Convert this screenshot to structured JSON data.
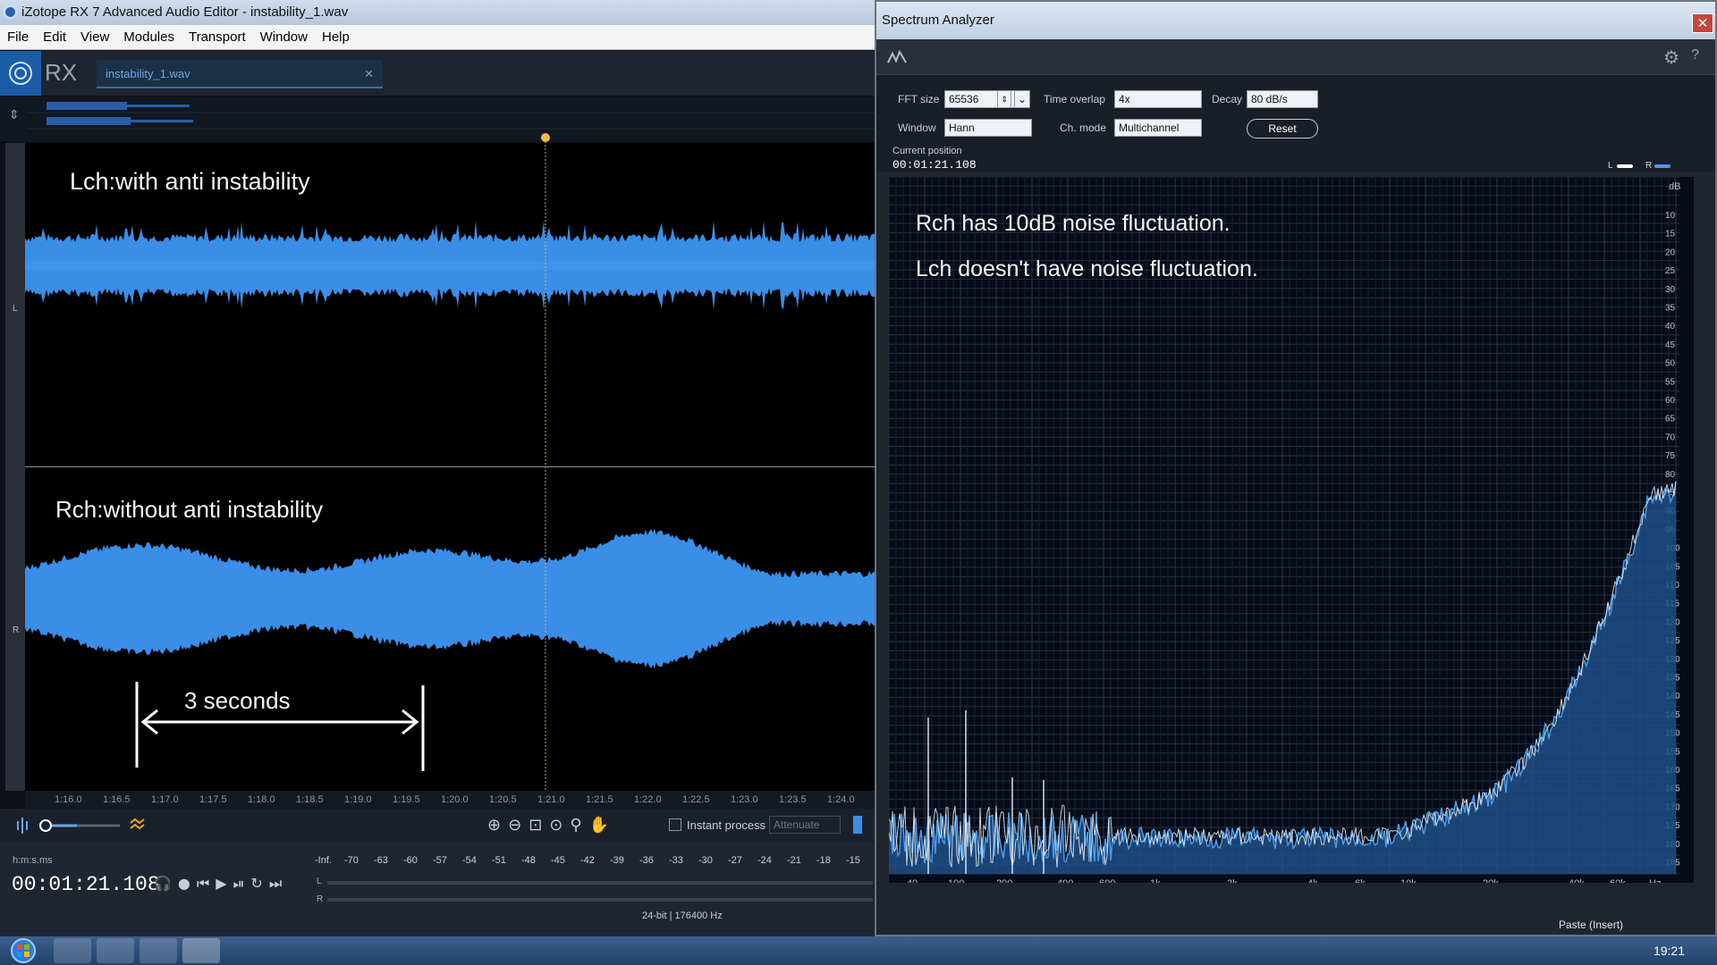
{
  "window": {
    "title": "iZotope RX 7 Advanced Audio Editor - instability_1.wav",
    "menu": [
      "File",
      "Edit",
      "View",
      "Modules",
      "Transport",
      "Window",
      "Help"
    ]
  },
  "rx": {
    "logo_text": "RX",
    "file_tab": "instability_1.wav"
  },
  "waveform": {
    "ch_left_label": "L",
    "ch_right_label": "R",
    "annotation_left": "Lch:with anti instability",
    "annotation_right": "Rch:without anti instability",
    "span_label": "3 seconds",
    "ruler_ticks": [
      "1:16.0",
      "1:16.5",
      "1:17.0",
      "1:17.5",
      "1:18.0",
      "1:18.5",
      "1:19.0",
      "1:19.5",
      "1:20.0",
      "1:20.5",
      "1:21.0",
      "1:21.5",
      "1:22.0",
      "1:22.5",
      "1:23.0",
      "1:23.5",
      "1:24.0"
    ]
  },
  "tools": {
    "instant_process": "Instant process",
    "attenuate": "Attenuate"
  },
  "transport": {
    "time_format": "h:m:s.ms",
    "time_value": "00:01:21.108",
    "meter_scale": [
      "-Inf.",
      "-70",
      "-63",
      "-60",
      "-57",
      "-54",
      "-51",
      "-48",
      "-45",
      "-42",
      "-39",
      "-36",
      "-33",
      "-30",
      "-27",
      "-24",
      "-21",
      "-18",
      "-15"
    ],
    "meter_l": "L",
    "meter_r": "R",
    "format_info": "24-bit | 176400 Hz"
  },
  "spectrum": {
    "title": "Spectrum Analyzer",
    "fft_label": "FFT size",
    "fft_value": "65536",
    "overlap_label": "Time overlap",
    "overlap_value": "4x",
    "decay_label": "Decay",
    "decay_value": "80 dB/s",
    "window_label": "Window",
    "window_value": "Hann",
    "chmode_label": "Ch. mode",
    "chmode_value": "Multichannel",
    "reset_label": "Reset",
    "pos_label": "Current position",
    "pos_value": "00:01:21.108",
    "legend_l": "L",
    "legend_r": "R",
    "db_unit": "dB",
    "db_ticks": [
      "10",
      "15",
      "20",
      "25",
      "30",
      "35",
      "40",
      "45",
      "50",
      "55",
      "60",
      "65",
      "70",
      "75",
      "80",
      "85",
      "90",
      "95",
      "100",
      "105",
      "110",
      "115",
      "120",
      "125",
      "130",
      "135",
      "140",
      "145",
      "150",
      "155",
      "160",
      "165",
      "170",
      "175",
      "180",
      "185"
    ],
    "freq_ticks": [
      "40",
      "100",
      "200",
      "400",
      "600",
      "1k",
      "2k",
      "4k",
      "6k",
      "10k",
      "20k",
      "40k",
      "60k"
    ],
    "freq_unit": "Hz",
    "annotation_1": "Rch has 10dB noise fluctuation.",
    "annotation_2": "Lch doesn't have noise fluctuation.",
    "status_text": "Paste (Insert)",
    "colors": {
      "left": "#e8edf3",
      "right": "#4a9ae8"
    }
  },
  "taskbar": {
    "clock": "19:21"
  }
}
